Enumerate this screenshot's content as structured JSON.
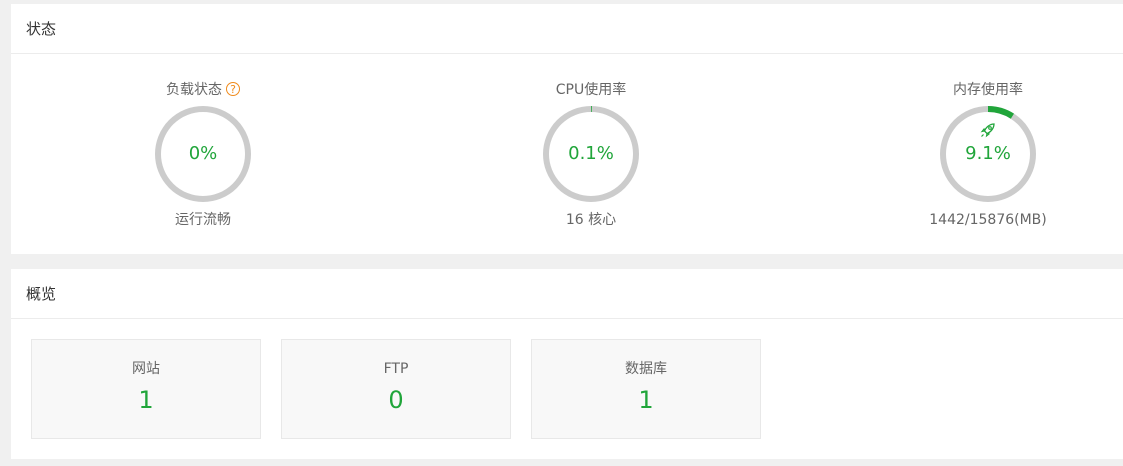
{
  "status_panel": {
    "title": "状态",
    "gauges": [
      {
        "title": "负载状态",
        "help_icon": "question-circle-icon",
        "help_glyph": "?",
        "value_text": "0%",
        "percent": 0,
        "subtitle": "运行流畅"
      },
      {
        "title": "CPU使用率",
        "value_text": "0.1%",
        "percent": 0.1,
        "subtitle": "16 核心"
      },
      {
        "title": "内存使用率",
        "icon": "rocket-icon",
        "value_text": "9.1%",
        "percent": 9.1,
        "subtitle": "1442/15876(MB)"
      }
    ]
  },
  "overview_panel": {
    "title": "概览",
    "cards": [
      {
        "label": "网站",
        "value": "1"
      },
      {
        "label": "FTP",
        "value": "0"
      },
      {
        "label": "数据库",
        "value": "1"
      }
    ]
  },
  "colors": {
    "accent_green": "#20a53a",
    "ring_track": "#cccccc",
    "help_orange": "#f08b1d"
  }
}
